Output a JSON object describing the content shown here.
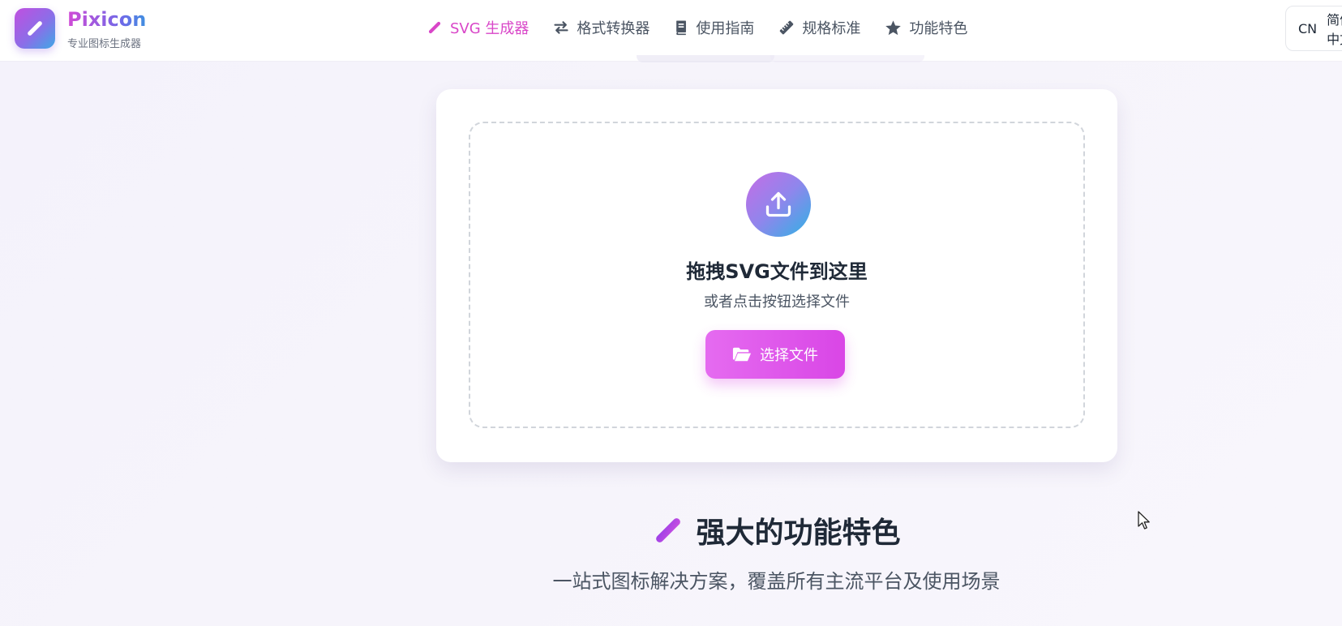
{
  "brand": {
    "name": "Pixicon",
    "subtitle": "专业图标生成器"
  },
  "nav": [
    {
      "label": "SVG 生成器",
      "icon": "pencil-icon",
      "active": true
    },
    {
      "label": "格式转换器",
      "icon": "exchange-icon",
      "active": false
    },
    {
      "label": "使用指南",
      "icon": "book-icon",
      "active": false
    },
    {
      "label": "规格标准",
      "icon": "ruler-icon",
      "active": false
    },
    {
      "label": "功能特色",
      "icon": "star-icon",
      "active": false
    }
  ],
  "language": {
    "code": "CN",
    "label": "简体中文"
  },
  "upload": {
    "title": "拖拽SVG文件到这里",
    "subtitle": "或者点击按钮选择文件",
    "button_label": "选择文件"
  },
  "features": {
    "title": "强大的功能特色",
    "subtitle": "一站式图标解决方案，覆盖所有主流平台及使用场景"
  },
  "colors": {
    "accent": "#d946c8",
    "button": "#e056ea",
    "icon_gradient_start": "#c04fe0",
    "icon_gradient_end": "#3ea8e6"
  }
}
